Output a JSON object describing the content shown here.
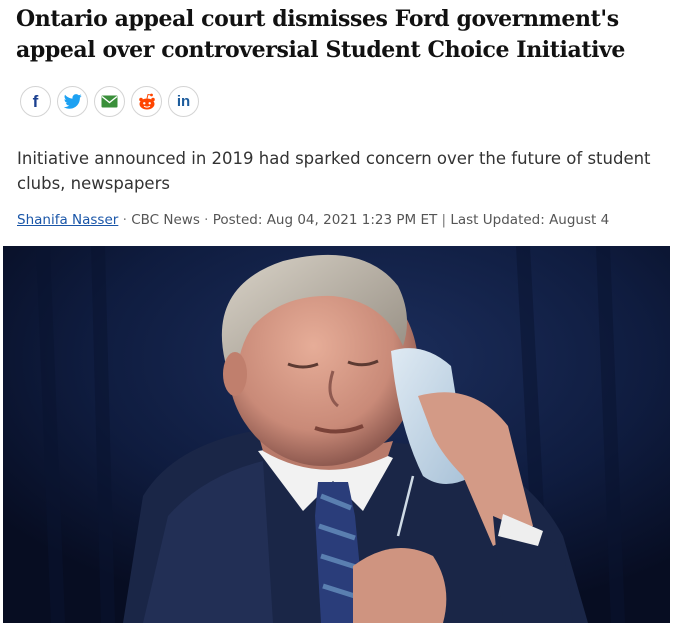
{
  "article": {
    "headline": "Ontario appeal court dismisses Ford government's appeal over controversial Student Choice Initiative",
    "deck": "Initiative announced in 2019 had sparked concern over the future of student clubs, newspapers",
    "byline": {
      "author": "Shanifa Nasser",
      "separator": " · ",
      "source": "CBC News",
      "posted": "Posted: Aug 04, 2021 1:23 PM ET",
      "divider": " | ",
      "updated": "Last Updated: August 4"
    }
  },
  "share": [
    {
      "icon": "facebook-icon",
      "glyph": "f",
      "color": "#1a3f8f"
    },
    {
      "icon": "twitter-icon",
      "color": "#1da1f2"
    },
    {
      "icon": "email-icon",
      "color": "#3a8f3a"
    },
    {
      "icon": "reddit-icon",
      "color": "#ff4500"
    },
    {
      "icon": "linkedin-icon",
      "glyph": "in",
      "color": "#1d5c9c"
    }
  ],
  "colors": {
    "link": "#1a56a8",
    "photo_background": "#0b1530"
  }
}
